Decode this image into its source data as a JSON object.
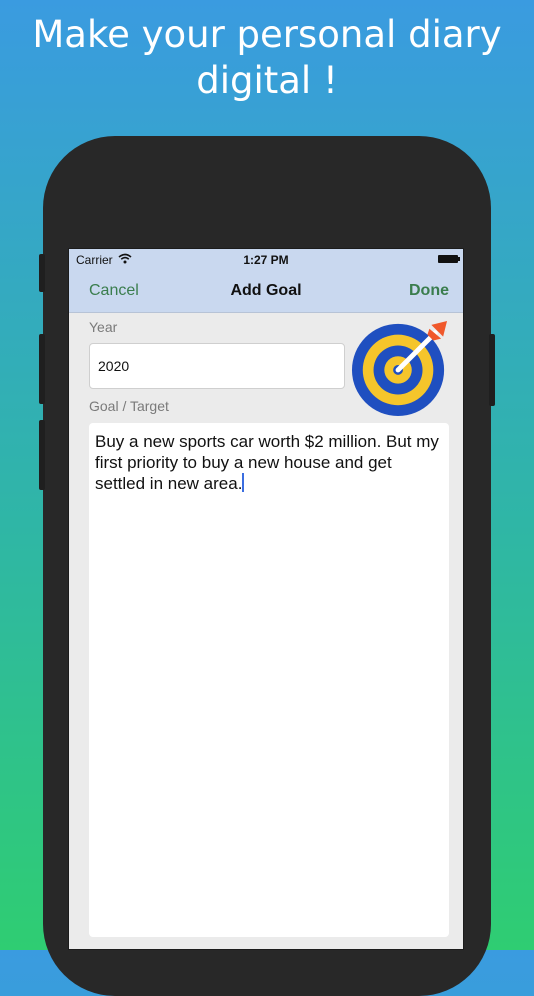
{
  "headline": "Make your personal diary digital !",
  "status_bar": {
    "carrier": "Carrier",
    "time": "1:27 PM"
  },
  "nav": {
    "cancel_label": "Cancel",
    "title": "Add Goal",
    "done_label": "Done"
  },
  "form": {
    "year_label": "Year",
    "year_value": "2020",
    "goal_label": "Goal / Target",
    "goal_value": "Buy a new sports car worth $2 million. But my first priority to buy a new house and get settled in new area."
  },
  "colors": {
    "nav_button": "#3a7d4d",
    "target_blue": "#1f4fc0",
    "target_yellow": "#f5c52b",
    "arrow_orange": "#f0582b"
  },
  "icons": [
    "wifi-icon",
    "battery-icon",
    "target-icon"
  ]
}
